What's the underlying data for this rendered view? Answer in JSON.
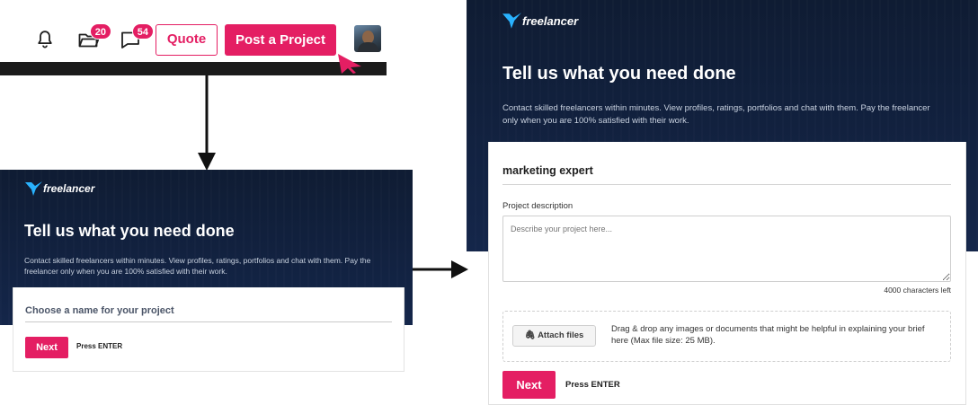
{
  "header": {
    "folders_badge": "20",
    "messages_badge": "54",
    "quote_label": "Quote",
    "post_label": "Post a Project",
    "icons": [
      "bell-icon",
      "folder-icon",
      "chat-icon"
    ]
  },
  "brand": {
    "name": "freelancer",
    "accent": "#e41e63",
    "navy": "#0f1c33"
  },
  "step1": {
    "heading": "Tell us what you need done",
    "subtext": "Contact skilled freelancers within minutes. View profiles, ratings, portfolios and chat with them. Pay the freelancer only when you are 100% satisfied with their work.",
    "name_label": "Choose a name for your project",
    "next_label": "Next",
    "press_hint": "Press ENTER"
  },
  "step2": {
    "heading": "Tell us what you need done",
    "subtext": "Contact skilled freelancers within minutes. View profiles, ratings, portfolios and chat with them. Pay the freelancer only when you are 100% satisfied with their work.",
    "project_title": "marketing expert",
    "description_label": "Project description",
    "description_placeholder": "Describe your project here...",
    "chars_left": "4000 characters left",
    "attach_label": "Attach files",
    "attach_hint": "Drag & drop any images or documents that might be helpful in explaining your brief here (Max file size: 25 MB).",
    "next_label": "Next",
    "press_hint": "Press ENTER"
  }
}
